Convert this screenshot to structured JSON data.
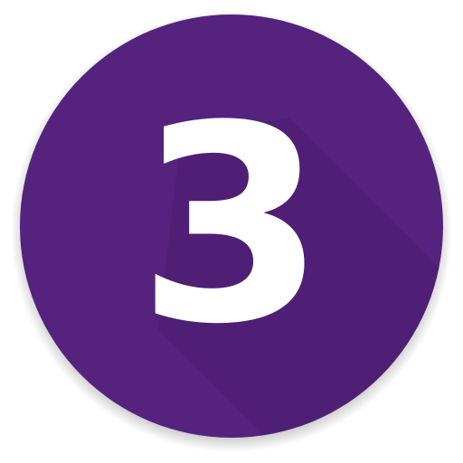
{
  "icon": {
    "name": "number-three-app-icon",
    "label": "3",
    "colors": {
      "circle": "#55237e",
      "shadow": "#4a1e6e",
      "edge_shadow": "#3a1556",
      "digit": "#ffffff"
    }
  }
}
